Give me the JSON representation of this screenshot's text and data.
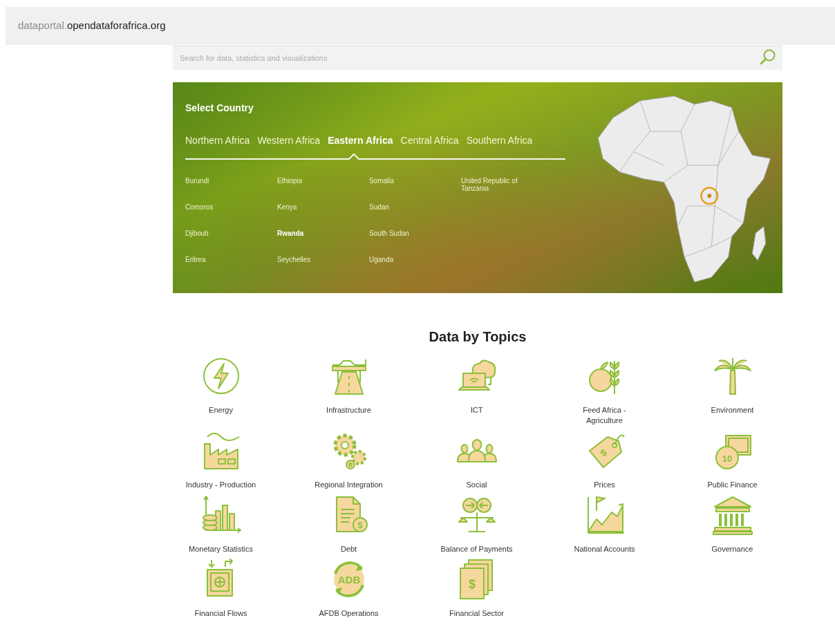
{
  "address_bar": {
    "subdomain": "dataportal.",
    "domain": "opendataforafrica.org"
  },
  "search": {
    "placeholder": "Search for data, statistics and visualizations"
  },
  "country_selector": {
    "title": "Select Country",
    "regions": [
      {
        "label": "Northern Africa",
        "selected": false
      },
      {
        "label": "Western Africa",
        "selected": false
      },
      {
        "label": "Eastern Africa",
        "selected": true
      },
      {
        "label": "Central Africa",
        "selected": false
      },
      {
        "label": "Southern Africa",
        "selected": false
      }
    ],
    "countries": [
      {
        "label": "Burundi",
        "selected": false
      },
      {
        "label": "Comoros",
        "selected": false
      },
      {
        "label": "Djibouti",
        "selected": false
      },
      {
        "label": "Eritrea",
        "selected": false
      },
      {
        "label": "Ethiopia",
        "selected": false
      },
      {
        "label": "Kenya",
        "selected": false
      },
      {
        "label": "Rwanda",
        "selected": true
      },
      {
        "label": "Seychelles",
        "selected": false
      },
      {
        "label": "Somalia",
        "selected": false
      },
      {
        "label": "Sudan",
        "selected": false
      },
      {
        "label": "South Sudan",
        "selected": false
      },
      {
        "label": "Uganda",
        "selected": false
      },
      {
        "label": "United Republic of Tanzania",
        "selected": false
      }
    ]
  },
  "topics": {
    "title": "Data by Topics",
    "items": [
      {
        "label": "Energy"
      },
      {
        "label": "Infrastructure"
      },
      {
        "label": "ICT"
      },
      {
        "label": "Feed Africa - Agriculture"
      },
      {
        "label": "Environment"
      },
      {
        "label": "Industry - Production"
      },
      {
        "label": "Regional Integration"
      },
      {
        "label": "Social"
      },
      {
        "label": "Prices",
        "icon_text": "$"
      },
      {
        "label": "Public Finance",
        "icon_text": "10"
      },
      {
        "label": "Monetary Statistics"
      },
      {
        "label": "Debt",
        "icon_text": "$"
      },
      {
        "label": "Balance of Payments"
      },
      {
        "label": "National Accounts"
      },
      {
        "label": "Governance"
      },
      {
        "label": "Financial Flows"
      },
      {
        "label": "AFDB Operations",
        "icon_text": "ADB"
      },
      {
        "label": "Financial Sector",
        "icon_text": "$"
      }
    ]
  }
}
